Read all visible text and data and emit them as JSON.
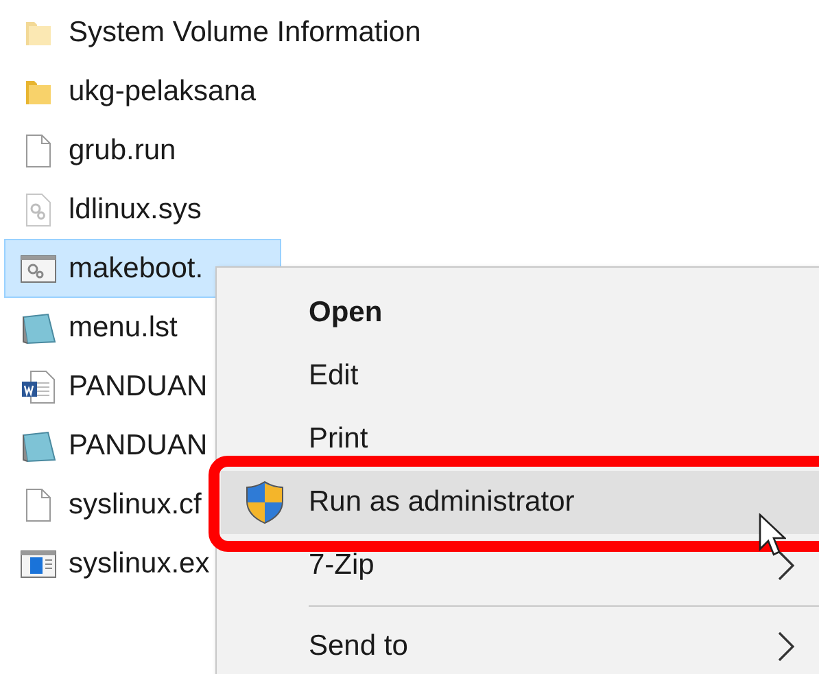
{
  "files": [
    {
      "name": "System Volume Information",
      "kind": "hidden_folder",
      "selected": false
    },
    {
      "name": "ukg-pelaksana",
      "kind": "folder",
      "selected": false
    },
    {
      "name": "grub.run",
      "kind": "file",
      "selected": false
    },
    {
      "name": "ldlinux.sys",
      "kind": "system",
      "selected": false
    },
    {
      "name": "makeboot.",
      "kind": "batch",
      "selected": true
    },
    {
      "name": "menu.lst",
      "kind": "notepad",
      "selected": false
    },
    {
      "name": "PANDUAN",
      "kind": "word",
      "selected": false
    },
    {
      "name": "PANDUAN",
      "kind": "notepad",
      "selected": false
    },
    {
      "name": "syslinux.cf",
      "kind": "file",
      "selected": false
    },
    {
      "name": "syslinux.ex",
      "kind": "app",
      "selected": false
    }
  ],
  "context_menu": {
    "items": [
      {
        "label": "Open",
        "kind": "default",
        "selected": false
      },
      {
        "label": "Edit",
        "kind": "plain",
        "selected": false
      },
      {
        "label": "Print",
        "kind": "plain",
        "selected": false
      },
      {
        "label": "Run as administrator",
        "kind": "shield",
        "selected": true
      },
      {
        "label": "7-Zip",
        "kind": "submenu",
        "selected": false
      },
      {
        "kind": "separator"
      },
      {
        "label": "Send to",
        "kind": "submenu",
        "selected": false
      }
    ]
  }
}
